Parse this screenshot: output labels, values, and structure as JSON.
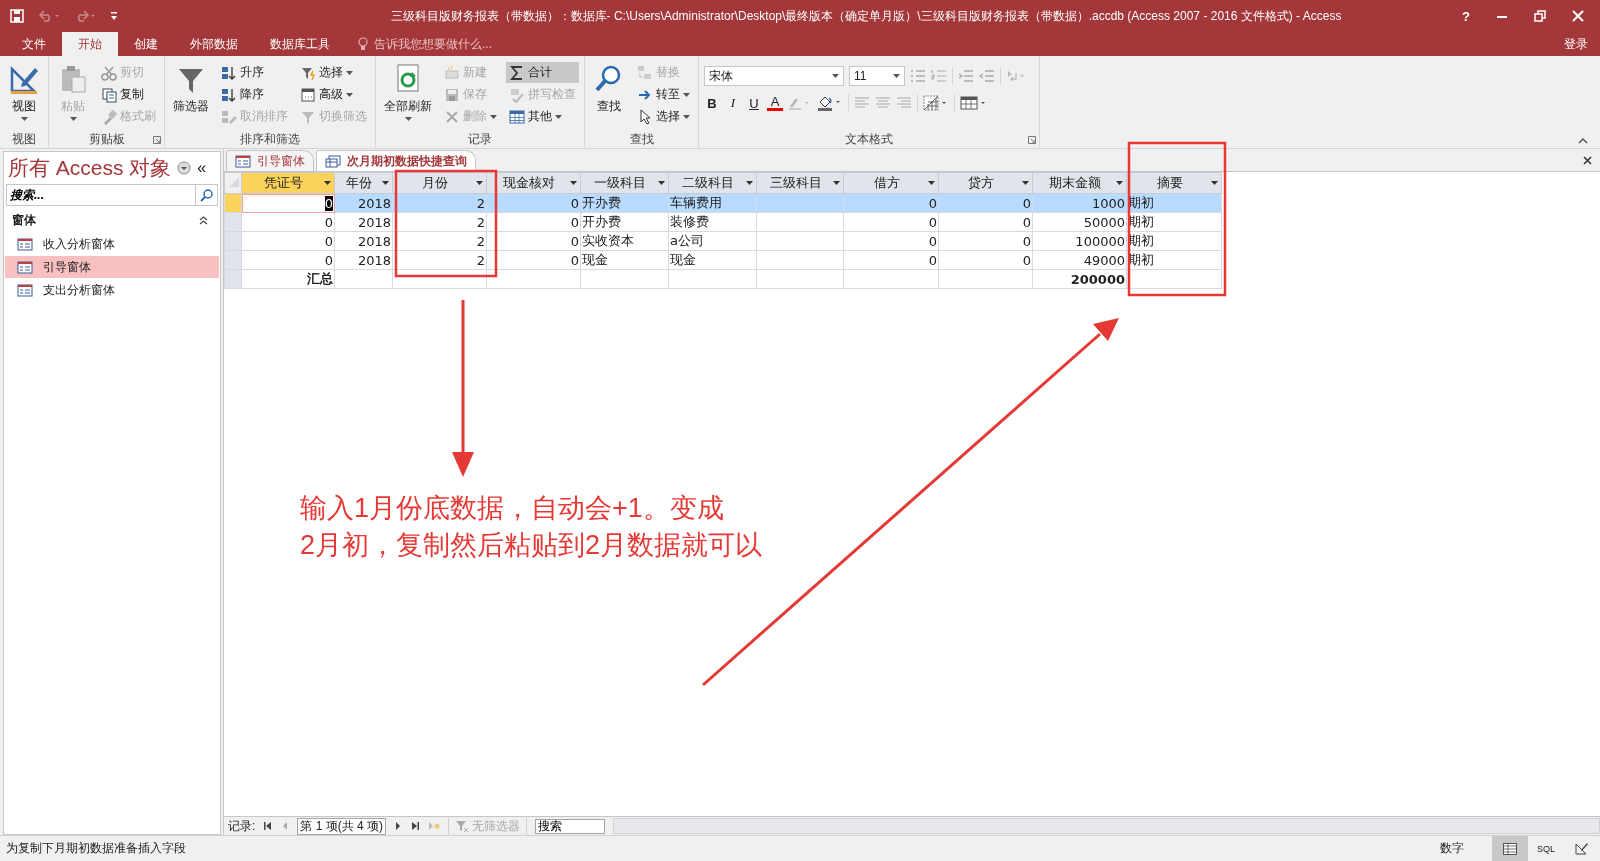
{
  "window": {
    "title": "三级科目版财务报表（带数据）：数据库- C:\\Users\\Administrator\\Desktop\\最终版本（确定单月版）\\三级科目版财务报表（带数据）.accdb (Access 2007 - 2016 文件格式) - Access",
    "help": "?",
    "sign_in": "登录"
  },
  "ribbon_tabs": [
    {
      "label": "文件",
      "selected": false
    },
    {
      "label": "开始",
      "selected": true
    },
    {
      "label": "创建",
      "selected": false
    },
    {
      "label": "外部数据",
      "selected": false
    },
    {
      "label": "数据库工具",
      "selected": false
    }
  ],
  "tell_me": {
    "placeholder": "告诉我您想要做什么..."
  },
  "ribbon_groups": [
    {
      "label": "视图",
      "large": {
        "label": "视图",
        "disabled": false,
        "dropdown": true
      }
    },
    {
      "label": "剪贴板",
      "launcher": true,
      "large": {
        "label": "粘贴",
        "disabled": true,
        "dropdown": true
      },
      "columns": [
        [
          {
            "label": "剪切",
            "disabled": true,
            "dropdown": false,
            "active": false
          },
          {
            "label": "复制",
            "disabled": false,
            "dropdown": false,
            "active": false
          },
          {
            "label": "格式刷",
            "disabled": true,
            "dropdown": false,
            "active": false
          }
        ]
      ]
    },
    {
      "label": "排序和筛选",
      "large": {
        "label": "筛选器",
        "disabled": false,
        "dropdown": false
      },
      "columns": [
        [
          {
            "label": "升序",
            "disabled": false,
            "dropdown": false,
            "active": false
          },
          {
            "label": "降序",
            "disabled": false,
            "dropdown": false,
            "active": false
          },
          {
            "label": "取消排序",
            "disabled": true,
            "dropdown": false,
            "active": false
          }
        ],
        [
          {
            "label": "选择",
            "disabled": false,
            "dropdown": true,
            "active": false
          },
          {
            "label": "高级",
            "disabled": false,
            "dropdown": true,
            "active": false
          },
          {
            "label": "切换筛选",
            "disabled": true,
            "dropdown": false,
            "active": false
          }
        ]
      ]
    },
    {
      "label": "记录",
      "large": {
        "label": "全部刷新",
        "disabled": false,
        "dropdown": true
      },
      "columns": [
        [
          {
            "label": "新建",
            "disabled": true,
            "dropdown": false,
            "active": false
          },
          {
            "label": "保存",
            "disabled": true,
            "dropdown": false,
            "active": false
          },
          {
            "label": "删除",
            "disabled": true,
            "dropdown": true,
            "active": false
          }
        ],
        [
          {
            "label": "合计",
            "disabled": false,
            "dropdown": false,
            "active": true
          },
          {
            "label": "拼写检查",
            "disabled": true,
            "dropdown": false,
            "active": false
          },
          {
            "label": "其他",
            "disabled": false,
            "dropdown": true,
            "active": false
          }
        ]
      ]
    },
    {
      "label": "查找",
      "large": {
        "label": "查找",
        "disabled": false,
        "dropdown": false
      },
      "columns": [
        [
          {
            "label": "替换",
            "disabled": true,
            "dropdown": false,
            "active": false
          },
          {
            "label": "转至",
            "disabled": false,
            "dropdown": true,
            "active": false
          },
          {
            "label": "选择",
            "disabled": false,
            "dropdown": true,
            "active": false
          }
        ]
      ]
    }
  ],
  "text_format": {
    "label": "文本格式",
    "launcher": true,
    "font": "宋体",
    "size": "11",
    "styles": [
      {
        "label": "B",
        "kind": "bold"
      },
      {
        "label": "I",
        "kind": "italic"
      },
      {
        "label": "U",
        "kind": "underline"
      },
      {
        "label": "A",
        "kind": "color"
      }
    ]
  },
  "nav_pane": {
    "title": "所有 Access 对象",
    "collapse": "«",
    "search": {
      "placeholder": "搜索..."
    },
    "section": "窗体",
    "items": [
      {
        "label": "收入分析窗体",
        "selected": false
      },
      {
        "label": "引导窗体",
        "selected": true
      },
      {
        "label": "支出分析窗体",
        "selected": false
      }
    ]
  },
  "doc_tabs": [
    {
      "label": "引导窗体",
      "selected": false
    },
    {
      "label": "次月期初数据快捷查询",
      "selected": true
    }
  ],
  "table": {
    "columns": [
      {
        "label": "凭证号",
        "selected": true,
        "numeric": true,
        "total": "汇总"
      },
      {
        "label": "年份",
        "selected": false,
        "numeric": true
      },
      {
        "label": "月份",
        "selected": false,
        "numeric": true
      },
      {
        "label": "现金核对",
        "selected": false,
        "numeric": true
      },
      {
        "label": "一级科目",
        "selected": false,
        "numeric": false
      },
      {
        "label": "二级科目",
        "selected": false,
        "numeric": false
      },
      {
        "label": "三级科目",
        "selected": false
      },
      {
        "label": "借方",
        "selected": false,
        "numeric": true
      },
      {
        "label": "贷方",
        "selected": false,
        "numeric": true
      },
      {
        "label": "期末金额",
        "selected": false,
        "numeric": true,
        "total": "200000"
      },
      {
        "label": "摘要",
        "selected": false,
        "numeric": false
      }
    ],
    "rows": [
      {
        "selected": true,
        "cells": [
          "0",
          "2018",
          "2",
          "0",
          "开办费",
          "车辆费用",
          null,
          "0",
          "0",
          "1000",
          "期初"
        ]
      },
      {
        "selected": false,
        "cells": [
          "0",
          "2018",
          "2",
          "0",
          "开办费",
          "装修费",
          null,
          "0",
          "0",
          "50000",
          "期初"
        ]
      },
      {
        "selected": false,
        "cells": [
          "0",
          "2018",
          "2",
          "0",
          "实收资本",
          "a公司",
          null,
          "0",
          "0",
          "100000",
          "期初"
        ]
      },
      {
        "selected": false,
        "cells": [
          "0",
          "2018",
          "2",
          "0",
          "现金",
          "现金",
          null,
          "0",
          "0",
          "49000",
          "期初"
        ]
      }
    ]
  },
  "record_nav": {
    "label": "记录:",
    "position": "第 1 项(共 4 项)",
    "filter": "无筛选器",
    "search": "搜索"
  },
  "status_bar": {
    "text": "为复制下月期初数据准备插入字段",
    "mode": "数字",
    "views": [
      {
        "kind": "datasheet",
        "selected": true
      },
      {
        "kind": "sql",
        "label": "SQL",
        "selected": false
      },
      {
        "kind": "design",
        "selected": false
      }
    ]
  },
  "annotation": {
    "text": "输入1月份底数据，自动会+1。变成\n2月初，复制然后粘贴到2月数据就可以"
  }
}
